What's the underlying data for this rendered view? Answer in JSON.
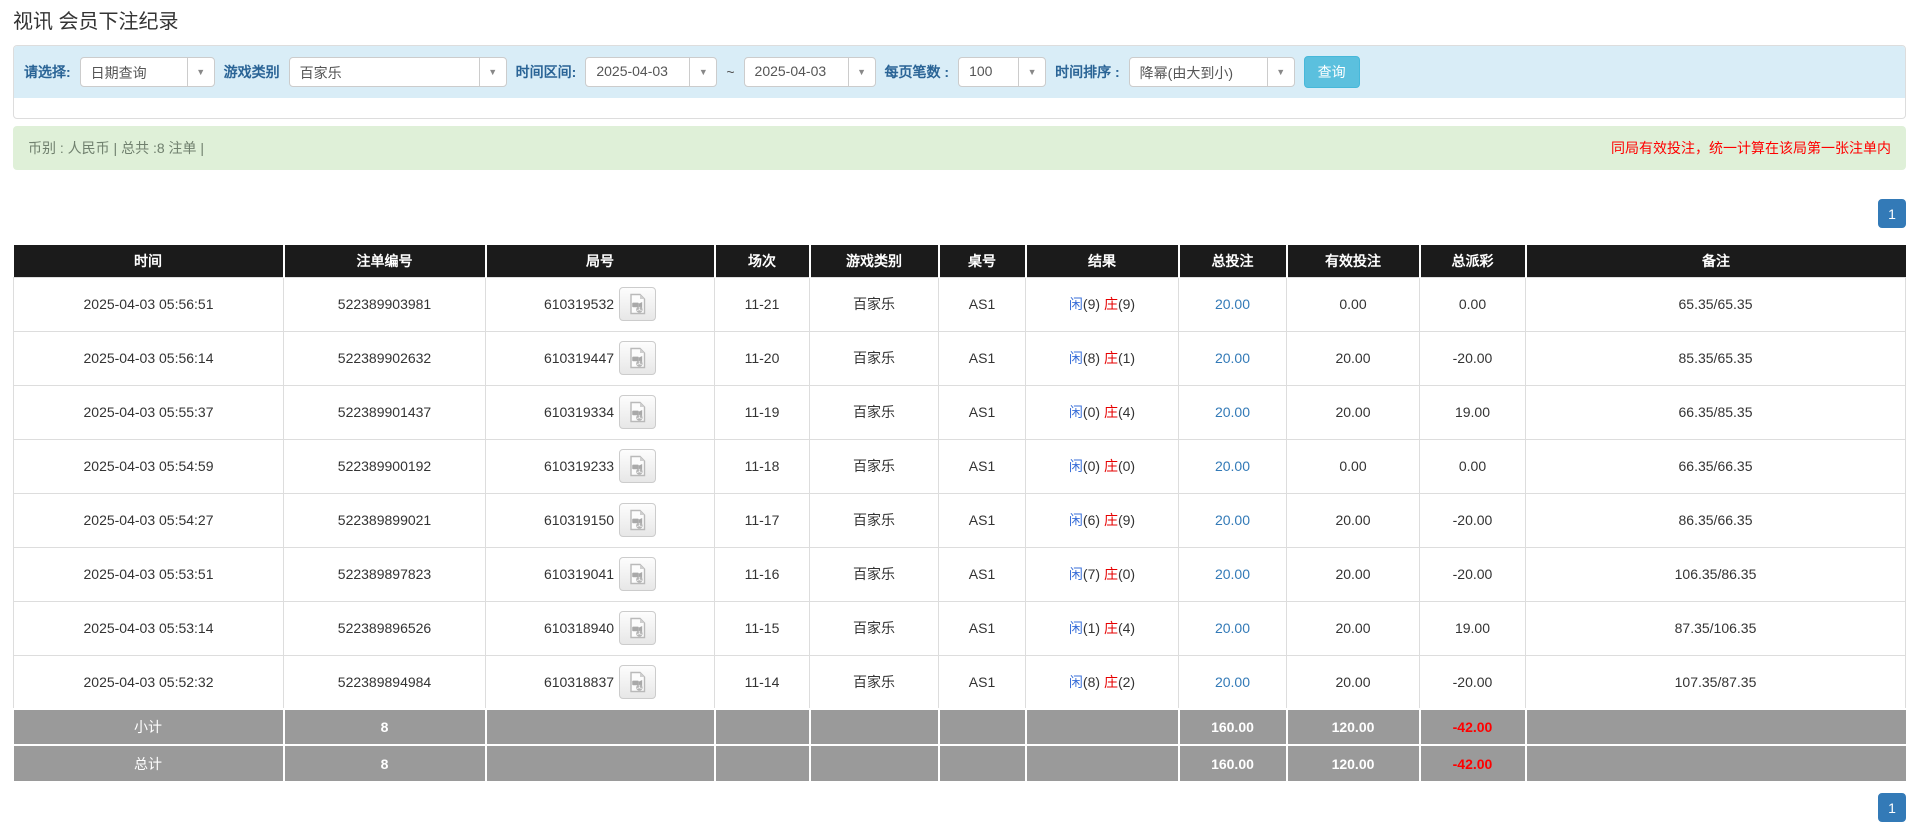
{
  "page": {
    "title": "视讯 会员下注纪录"
  },
  "colors": {
    "accent_blue": "#337ab7",
    "link_blue": "#337ab7",
    "player_blue": "#3a6fd8",
    "banker_red": "#e60000",
    "neg_red": "#ff0000",
    "note_red": "#ff0000",
    "label_blue": "#2a6496",
    "filter_bg": "#d9edf7",
    "success_bg": "#dff0d8",
    "button_bg": "#5bc0de",
    "header_bg": "#1b1b1b",
    "summary_bg": "#9a9a9a"
  },
  "filters": {
    "choose_label": "请选择:",
    "choose_value": "日期查询",
    "game_label": "游戏类别",
    "game_value": "百家乐",
    "range_label": "时间区间:",
    "date_from": "2025-04-03",
    "range_sep": "~",
    "date_to": "2025-04-03",
    "perpage_label": "每页笔数 :",
    "perpage_value": "100",
    "sort_label": "时间排序 :",
    "sort_value": "降幂(由大到小)",
    "search_label": "查询"
  },
  "summary_bar": {
    "left": "币别 : 人民币 | 总共 :8 注单 |",
    "right": "同局有效投注，统一计算在该局第一张注单内"
  },
  "pagination": {
    "page": "1"
  },
  "table": {
    "headers": [
      "时间",
      "注单编号",
      "局号",
      "场次",
      "游戏类别",
      "桌号",
      "结果",
      "总投注",
      "有效投注",
      "总派彩",
      "备注"
    ],
    "rows": [
      {
        "time": "2025-04-03 05:56:51",
        "bet_id": "522389903981",
        "round_id": "610319532",
        "session": "11-21",
        "game": "百家乐",
        "table_no": "AS1",
        "player_label": "闲",
        "player_value": "(9)",
        "banker_label": "庄",
        "banker_value": "(9)",
        "total_bet": "20.00",
        "valid_bet": "0.00",
        "payout": "0.00",
        "remark": "65.35/65.35"
      },
      {
        "time": "2025-04-03 05:56:14",
        "bet_id": "522389902632",
        "round_id": "610319447",
        "session": "11-20",
        "game": "百家乐",
        "table_no": "AS1",
        "player_label": "闲",
        "player_value": "(8)",
        "banker_label": "庄",
        "banker_value": "(1)",
        "total_bet": "20.00",
        "valid_bet": "20.00",
        "payout": "-20.00",
        "remark": "85.35/65.35"
      },
      {
        "time": "2025-04-03 05:55:37",
        "bet_id": "522389901437",
        "round_id": "610319334",
        "session": "11-19",
        "game": "百家乐",
        "table_no": "AS1",
        "player_label": "闲",
        "player_value": "(0)",
        "banker_label": "庄",
        "banker_value": "(4)",
        "total_bet": "20.00",
        "valid_bet": "20.00",
        "payout": "19.00",
        "remark": "66.35/85.35"
      },
      {
        "time": "2025-04-03 05:54:59",
        "bet_id": "522389900192",
        "round_id": "610319233",
        "session": "11-18",
        "game": "百家乐",
        "table_no": "AS1",
        "player_label": "闲",
        "player_value": "(0)",
        "banker_label": "庄",
        "banker_value": "(0)",
        "total_bet": "20.00",
        "valid_bet": "0.00",
        "payout": "0.00",
        "remark": "66.35/66.35"
      },
      {
        "time": "2025-04-03 05:54:27",
        "bet_id": "522389899021",
        "round_id": "610319150",
        "session": "11-17",
        "game": "百家乐",
        "table_no": "AS1",
        "player_label": "闲",
        "player_value": "(6)",
        "banker_label": "庄",
        "banker_value": "(9)",
        "total_bet": "20.00",
        "valid_bet": "20.00",
        "payout": "-20.00",
        "remark": "86.35/66.35"
      },
      {
        "time": "2025-04-03 05:53:51",
        "bet_id": "522389897823",
        "round_id": "610319041",
        "session": "11-16",
        "game": "百家乐",
        "table_no": "AS1",
        "player_label": "闲",
        "player_value": "(7)",
        "banker_label": "庄",
        "banker_value": "(0)",
        "total_bet": "20.00",
        "valid_bet": "20.00",
        "payout": "-20.00",
        "remark": "106.35/86.35"
      },
      {
        "time": "2025-04-03 05:53:14",
        "bet_id": "522389896526",
        "round_id": "610318940",
        "session": "11-15",
        "game": "百家乐",
        "table_no": "AS1",
        "player_label": "闲",
        "player_value": "(1)",
        "banker_label": "庄",
        "banker_value": "(4)",
        "total_bet": "20.00",
        "valid_bet": "20.00",
        "payout": "19.00",
        "remark": "87.35/106.35"
      },
      {
        "time": "2025-04-03 05:52:32",
        "bet_id": "522389894984",
        "round_id": "610318837",
        "session": "11-14",
        "game": "百家乐",
        "table_no": "AS1",
        "player_label": "闲",
        "player_value": "(8)",
        "banker_label": "庄",
        "banker_value": "(2)",
        "total_bet": "20.00",
        "valid_bet": "20.00",
        "payout": "-20.00",
        "remark": "107.35/87.35"
      }
    ],
    "subtotal": {
      "label": "小计",
      "count": "8",
      "total_bet": "160.00",
      "valid_bet": "120.00",
      "payout": "-42.00"
    },
    "total": {
      "label": "总计",
      "count": "8",
      "total_bet": "160.00",
      "valid_bet": "120.00",
      "payout": "-42.00"
    }
  }
}
